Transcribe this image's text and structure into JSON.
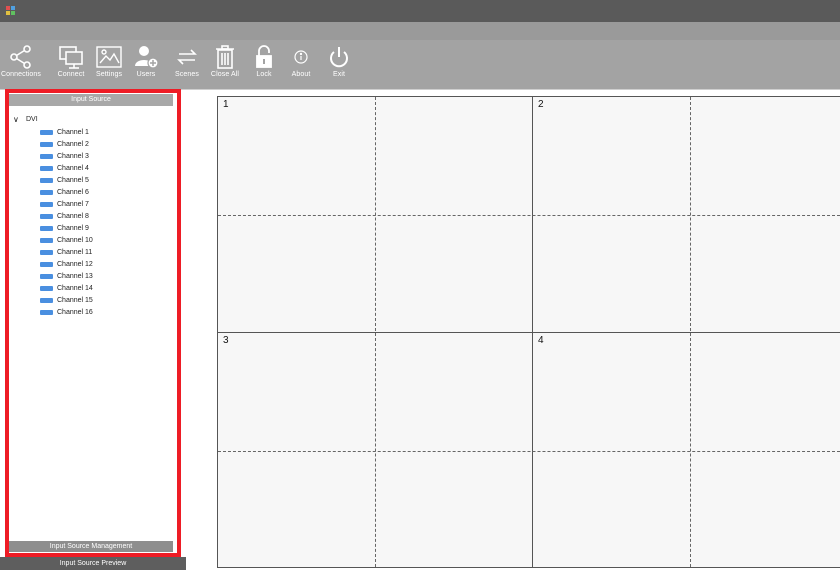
{
  "toolbar": {
    "items": [
      {
        "label": "Connections",
        "icon": "connections-icon"
      },
      {
        "label": "Connect",
        "icon": "monitor-icon"
      },
      {
        "label": "Settings",
        "icon": "settings-icon"
      },
      {
        "label": "Users",
        "icon": "user-add-icon"
      },
      {
        "label": "Scenes",
        "icon": "swap-icon"
      },
      {
        "label": "Close All",
        "icon": "trash-icon"
      },
      {
        "label": "Lock",
        "icon": "lock-icon"
      },
      {
        "label": "About",
        "icon": "info-icon"
      },
      {
        "label": "Exit",
        "icon": "power-icon"
      }
    ]
  },
  "input_source": {
    "title": "Input Source",
    "group": "DVI",
    "channels": [
      "Channel 1",
      "Channel 2",
      "Channel 3",
      "Channel 4",
      "Channel 5",
      "Channel 6",
      "Channel 7",
      "Channel 8",
      "Channel 9",
      "Channel 10",
      "Channel 11",
      "Channel 12",
      "Channel 13",
      "Channel 14",
      "Channel 15",
      "Channel 16"
    ],
    "management_label": "Input Source Management",
    "preview_label": "Input Source Preview"
  },
  "screens": {
    "labels": [
      "1",
      "2",
      "3",
      "4"
    ]
  },
  "colors": {
    "highlight": "#ee1c25",
    "channel_swatch": "#4a8fe0"
  }
}
